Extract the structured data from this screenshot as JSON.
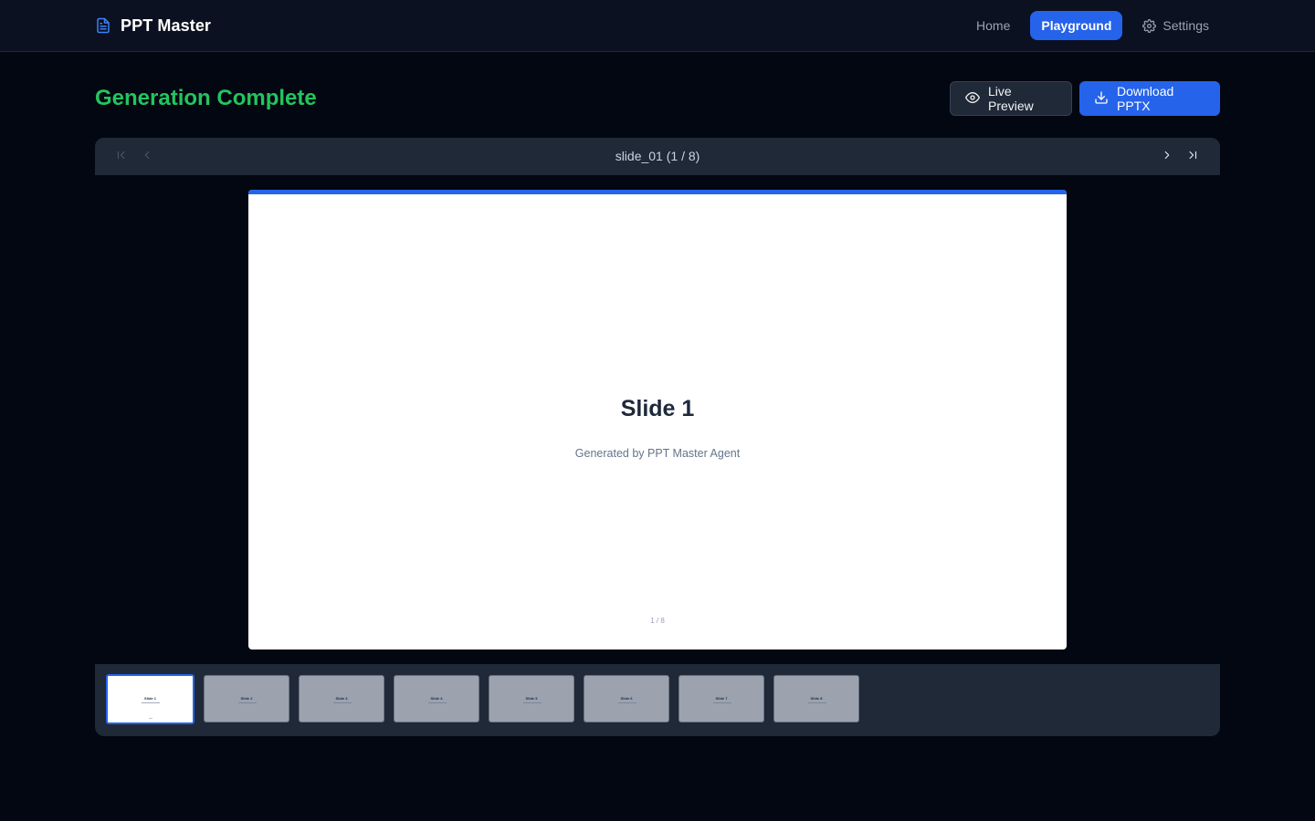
{
  "app": {
    "name": "PPT Master"
  },
  "nav": {
    "items": [
      {
        "label": "Home",
        "active": false
      },
      {
        "label": "Playground",
        "active": true
      },
      {
        "label": "Settings",
        "active": false
      }
    ]
  },
  "header": {
    "title": "Generation Complete",
    "live_preview_label": "Live Preview",
    "download_label": "Download PPTX"
  },
  "viewer": {
    "slide_label": "slide_01 (1 / 8)",
    "current_slide": 1,
    "total_slides": 8
  },
  "slide": {
    "title": "Slide 1",
    "subtitle": "Generated by PPT Master Agent",
    "page_number": "1 / 8"
  },
  "thumbnails": [
    {
      "title": "Slide 1",
      "active": true
    },
    {
      "title": "Slide 2",
      "active": false
    },
    {
      "title": "Slide 3",
      "active": false
    },
    {
      "title": "Slide 4",
      "active": false
    },
    {
      "title": "Slide 5",
      "active": false
    },
    {
      "title": "Slide 6",
      "active": false
    },
    {
      "title": "Slide 7",
      "active": false
    },
    {
      "title": "Slide 8",
      "active": false
    }
  ],
  "colors": {
    "accent": "#2563eb",
    "success": "#22c55e",
    "background": "#030712",
    "panel": "#1f2937"
  },
  "icons": {
    "brand": "file-text-icon",
    "settings": "gear-icon",
    "live_preview": "eye-icon",
    "download": "download-icon",
    "first": "chevrons-first-icon",
    "prev": "chevron-left-icon",
    "next": "chevron-right-icon",
    "last": "chevrons-last-icon"
  }
}
